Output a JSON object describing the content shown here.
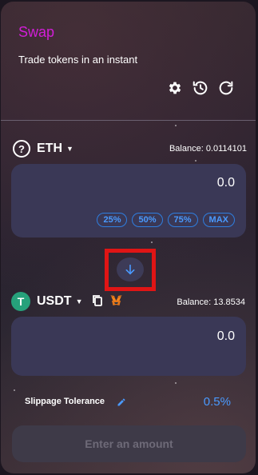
{
  "header": {
    "title": "Swap",
    "subtitle": "Trade tokens in an instant"
  },
  "toolbar": {
    "icons": [
      "gear-icon",
      "history-icon",
      "refresh-icon"
    ]
  },
  "from": {
    "symbol": "ETH",
    "icon": "question-icon",
    "balance": "Balance: 0.0114101",
    "amount": "0.0",
    "percent_buttons": [
      "25%",
      "50%",
      "75%",
      "MAX"
    ]
  },
  "switch": {
    "icon": "arrow-down-icon",
    "highlight_color": "#e01515"
  },
  "to": {
    "symbol": "USDT",
    "icon": "usdt-icon",
    "icon_letter": "T",
    "balance": "Balance: 13.8534",
    "amount": "0.0",
    "extra_icons": [
      "copy-icon",
      "metamask-icon"
    ]
  },
  "slippage": {
    "label": "Slippage Tolerance",
    "value": "0.5%"
  },
  "action": {
    "label": "Enter an amount"
  },
  "colors": {
    "title": "#d21ed8",
    "accent": "#4a9aff",
    "panel": "#3a3856"
  }
}
